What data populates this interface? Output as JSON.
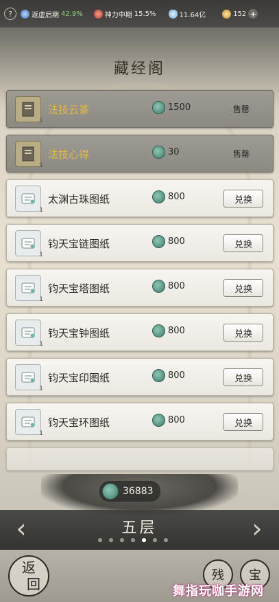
{
  "topbar": {
    "help": "?",
    "realm1": {
      "label": "返虚后期",
      "pct": "42.9%"
    },
    "realm2": {
      "label": "神力中期",
      "pct": "15.5%"
    },
    "spirit_stones": "11.64亿",
    "currency": "152",
    "plus": "+"
  },
  "title": "藏经阁",
  "items": [
    {
      "name": "法技云篆",
      "qty": "1",
      "price": "1500",
      "action": "售罄",
      "state": "sold"
    },
    {
      "name": "法技心得",
      "qty": "1",
      "price": "30",
      "action": "售罄",
      "state": "sold"
    },
    {
      "name": "太渊古珠图纸",
      "qty": "1",
      "price": "800",
      "action": "兑换",
      "state": "open"
    },
    {
      "name": "钧天宝链图纸",
      "qty": "1",
      "price": "800",
      "action": "兑换",
      "state": "open"
    },
    {
      "name": "钧天宝塔图纸",
      "qty": "1",
      "price": "800",
      "action": "兑换",
      "state": "open"
    },
    {
      "name": "钧天宝钟图纸",
      "qty": "1",
      "price": "800",
      "action": "兑换",
      "state": "open"
    },
    {
      "name": "钧天宝印图纸",
      "qty": "1",
      "price": "800",
      "action": "兑换",
      "state": "open"
    },
    {
      "name": "钧天宝环图纸",
      "qty": "1",
      "price": "800",
      "action": "兑换",
      "state": "open"
    }
  ],
  "balance": "36883",
  "floor": {
    "label": "五层",
    "page_count": 7,
    "active_page": 5
  },
  "nav": {
    "left_arrow": "‹",
    "right_arrow": "›"
  },
  "bottom": {
    "back_top": "返",
    "back_bottom": "回",
    "btn1": "残",
    "btn2": "宝"
  },
  "watermark": "舞指玩咖手游网",
  "colors": {
    "locked_name": "#e0b94a",
    "accent_green": "#3e7a6a"
  }
}
